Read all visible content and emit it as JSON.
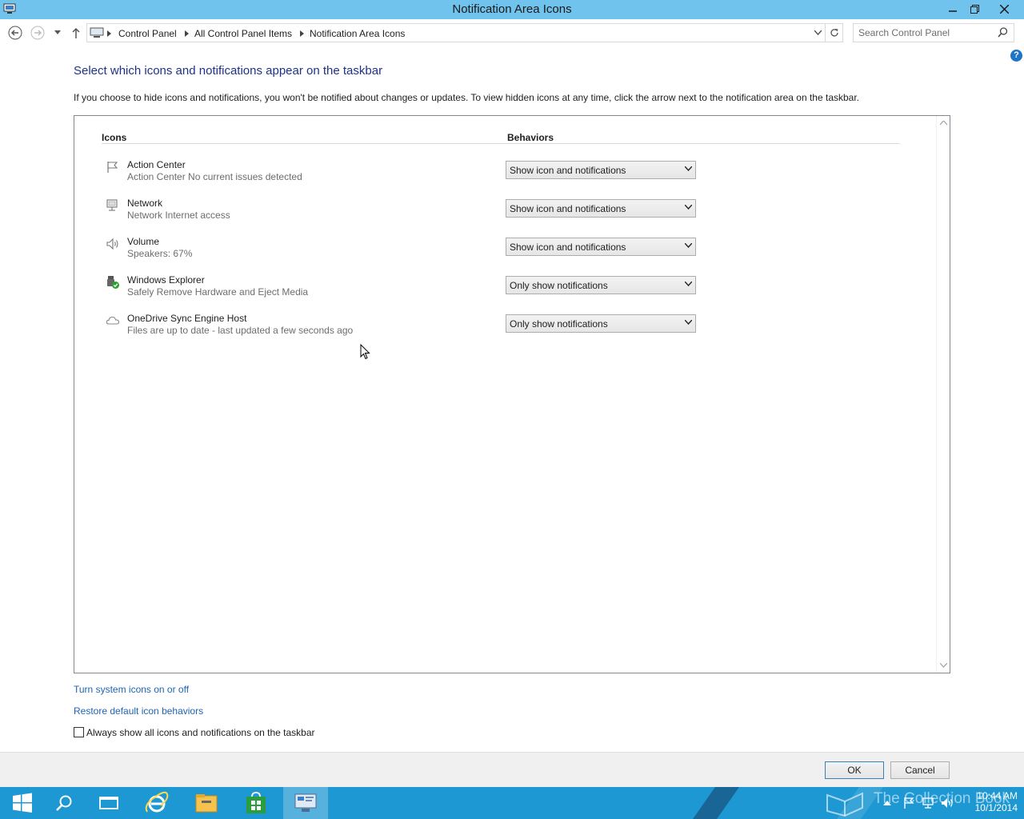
{
  "window": {
    "title": "Notification Area Icons",
    "controls": {
      "minimize": "minimize",
      "restore": "restore",
      "close": "close"
    }
  },
  "address_bar": {
    "breadcrumbs": [
      "Control Panel",
      "All Control Panel Items",
      "Notification Area Icons"
    ],
    "search_placeholder": "Search Control Panel"
  },
  "main": {
    "heading": "Select which icons and notifications appear on the taskbar",
    "description": "If you choose to hide icons and notifications, you won't be notified about changes or updates. To view hidden icons at any time, click the arrow next to the notification area on the taskbar.",
    "columns": {
      "icons": "Icons",
      "behaviors": "Behaviors"
    },
    "items": [
      {
        "name": "Action Center",
        "detail": "Action Center  No current issues detected",
        "behavior": "Show icon and notifications",
        "icon": "flag-icon"
      },
      {
        "name": "Network",
        "detail": "Network Internet access",
        "behavior": "Show icon and notifications",
        "icon": "network-icon"
      },
      {
        "name": "Volume",
        "detail": "Speakers: 67%",
        "behavior": "Show icon and notifications",
        "icon": "speaker-icon"
      },
      {
        "name": "Windows Explorer",
        "detail": "Safely Remove Hardware and Eject Media",
        "behavior": "Only show notifications",
        "icon": "usb-eject-icon"
      },
      {
        "name": "OneDrive Sync Engine Host",
        "detail": "Files are up to date - last updated a few seconds ago",
        "behavior": "Only show notifications",
        "icon": "cloud-icon"
      }
    ],
    "links": {
      "system_icons": "Turn system icons on or off",
      "restore_defaults": "Restore default icon behaviors"
    },
    "always_show": {
      "label": "Always show all icons and notifications on the taskbar",
      "checked": false
    }
  },
  "buttons": {
    "ok": "OK",
    "cancel": "Cancel"
  },
  "taskbar": {
    "time": "10:44 AM",
    "date": "10/1/2014",
    "watermark": "The Collection Book",
    "items": [
      "start-icon",
      "search-icon",
      "task-view-icon",
      "internet-explorer-icon",
      "file-explorer-icon",
      "store-icon",
      "control-panel-icon"
    ]
  },
  "colors": {
    "titlebar": "#6fc3ec",
    "taskbar": "#1e98d2",
    "heading": "#1e3287",
    "link": "#1e64b4"
  }
}
